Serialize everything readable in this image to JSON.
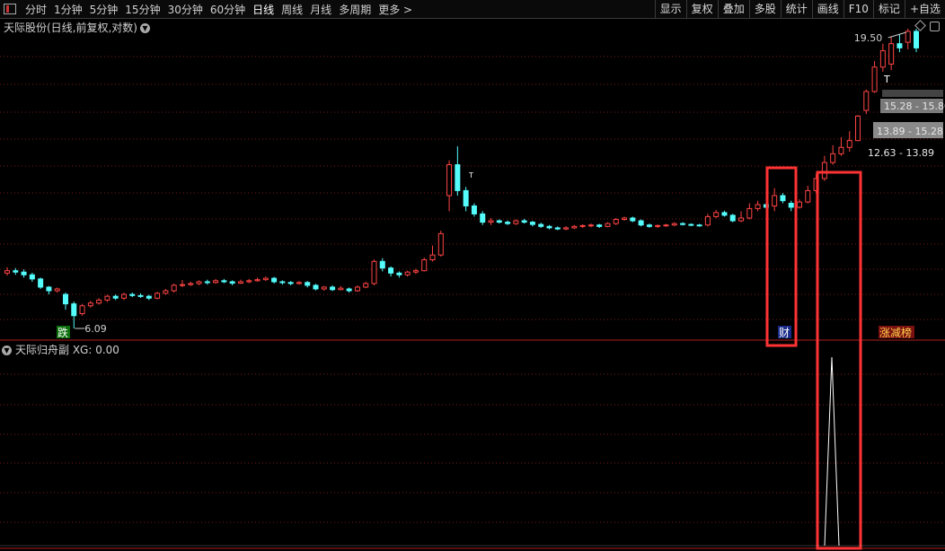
{
  "toolbar": {
    "periods": [
      "分时",
      "1分钟",
      "5分钟",
      "15分钟",
      "30分钟",
      "60分钟",
      "日线",
      "周线",
      "月线",
      "多周期",
      "更多 >"
    ],
    "active_period": "日线",
    "right_buttons": [
      "显示",
      "复权",
      "叠加",
      "多股",
      "统计",
      "画线",
      "F10",
      "标记",
      "+自选"
    ]
  },
  "chart": {
    "title": "天际股份(日线,前复权,对数)",
    "high_label": "19.50",
    "low_label": "6.09",
    "marker_die": "跌",
    "marker_cai": "财",
    "marker_zdb": "涨减榜",
    "zones": [
      "15.28 - 15.80",
      "13.89 - 15.28",
      "12.63 - 13.89"
    ],
    "t_marks": [
      "T",
      "T"
    ]
  },
  "indicator": {
    "title": "天际归舟副 XG: 0.00",
    "value": 0.0
  },
  "colors": {
    "up": "#ff4444",
    "down": "#54fcfc",
    "grid": "#7a1a1a",
    "box": "#ff3333"
  },
  "chart_data": {
    "type": "candlestick",
    "title": "天际股份(日线,前复权,对数)",
    "candles": [
      [
        7.55,
        7.62,
        7.72,
        7.48
      ],
      [
        7.62,
        7.58,
        7.7,
        7.5
      ],
      [
        7.58,
        7.5,
        7.66,
        7.42
      ],
      [
        7.5,
        7.38,
        7.56,
        7.3
      ],
      [
        7.38,
        7.15,
        7.42,
        7.1
      ],
      [
        7.15,
        7.05,
        7.18,
        6.95
      ],
      [
        7.05,
        7.1,
        7.14,
        7.0
      ],
      [
        6.95,
        6.7,
        7.0,
        6.55
      ],
      [
        6.7,
        6.4,
        6.76,
        6.09
      ],
      [
        6.45,
        6.65,
        6.7,
        6.4
      ],
      [
        6.65,
        6.72,
        6.78,
        6.6
      ],
      [
        6.72,
        6.8,
        6.85,
        6.68
      ],
      [
        6.8,
        6.9,
        6.94,
        6.75
      ],
      [
        6.9,
        6.85,
        6.95,
        6.8
      ],
      [
        6.85,
        6.95,
        7.0,
        6.8
      ],
      [
        6.95,
        6.92,
        7.0,
        6.88
      ],
      [
        6.92,
        6.9,
        6.98,
        6.86
      ],
      [
        6.9,
        6.85,
        6.94,
        6.8
      ],
      [
        6.85,
        6.98,
        7.02,
        6.82
      ],
      [
        6.98,
        7.05,
        7.1,
        6.94
      ],
      [
        7.05,
        7.2,
        7.25,
        7.0
      ],
      [
        7.2,
        7.22,
        7.35,
        7.15
      ],
      [
        7.22,
        7.25,
        7.3,
        7.18
      ],
      [
        7.25,
        7.3,
        7.34,
        7.2
      ],
      [
        7.3,
        7.28,
        7.36,
        7.22
      ],
      [
        7.28,
        7.33,
        7.38,
        7.24
      ],
      [
        7.33,
        7.3,
        7.38,
        7.26
      ],
      [
        7.3,
        7.26,
        7.34,
        7.2
      ],
      [
        7.26,
        7.3,
        7.36,
        7.24
      ],
      [
        7.3,
        7.33,
        7.38,
        7.26
      ],
      [
        7.33,
        7.36,
        7.42,
        7.3
      ],
      [
        7.36,
        7.4,
        7.45,
        7.32
      ],
      [
        7.4,
        7.3,
        7.44,
        7.25
      ],
      [
        7.3,
        7.28,
        7.34,
        7.22
      ],
      [
        7.28,
        7.25,
        7.32,
        7.2
      ],
      [
        7.25,
        7.28,
        7.32,
        7.22
      ],
      [
        7.28,
        7.2,
        7.32,
        7.14
      ],
      [
        7.2,
        7.1,
        7.24,
        7.06
      ],
      [
        7.1,
        7.15,
        7.18,
        7.05
      ],
      [
        7.15,
        7.08,
        7.2,
        7.04
      ],
      [
        7.08,
        7.12,
        7.18,
        7.06
      ],
      [
        7.1,
        7.05,
        7.14,
        7.0
      ],
      [
        7.05,
        7.15,
        7.2,
        7.02
      ],
      [
        7.15,
        7.25,
        7.3,
        7.12
      ],
      [
        7.25,
        7.9,
        7.96,
        7.2
      ],
      [
        7.9,
        7.7,
        8.0,
        7.6
      ],
      [
        7.7,
        7.55,
        7.75,
        7.45
      ],
      [
        7.55,
        7.5,
        7.6,
        7.42
      ],
      [
        7.5,
        7.58,
        7.62,
        7.45
      ],
      [
        7.58,
        7.62,
        7.68,
        7.52
      ],
      [
        7.62,
        7.95,
        8.02,
        7.6
      ],
      [
        7.95,
        8.1,
        8.4,
        7.9
      ],
      [
        8.1,
        8.8,
        8.9,
        8.05
      ],
      [
        10.2,
        11.5,
        11.7,
        9.6
      ],
      [
        11.5,
        10.4,
        12.35,
        10.2
      ],
      [
        10.4,
        9.8,
        10.55,
        9.6
      ],
      [
        9.8,
        9.5,
        9.9,
        9.4
      ],
      [
        9.5,
        9.2,
        9.6,
        9.1
      ],
      [
        9.2,
        9.25,
        9.35,
        9.1
      ],
      [
        9.25,
        9.2,
        9.3,
        9.15
      ],
      [
        9.2,
        9.15,
        9.26,
        9.1
      ],
      [
        9.15,
        9.25,
        9.3,
        9.1
      ],
      [
        9.25,
        9.2,
        9.32,
        9.15
      ],
      [
        9.2,
        9.12,
        9.25,
        9.05
      ],
      [
        9.12,
        9.05,
        9.18,
        9.0
      ],
      [
        9.05,
        9.0,
        9.1,
        8.95
      ],
      [
        9.0,
        8.96,
        9.05,
        8.92
      ],
      [
        8.96,
        9.0,
        9.06,
        8.92
      ],
      [
        9.0,
        9.05,
        9.1,
        8.96
      ],
      [
        9.05,
        9.08,
        9.12,
        9.0
      ],
      [
        9.08,
        9.1,
        9.15,
        9.02
      ],
      [
        9.1,
        9.05,
        9.14,
        9.0
      ],
      [
        9.05,
        9.15,
        9.2,
        9.02
      ],
      [
        9.15,
        9.3,
        9.35,
        9.1
      ],
      [
        9.3,
        9.35,
        9.4,
        9.25
      ],
      [
        9.35,
        9.25,
        9.4,
        9.2
      ],
      [
        9.25,
        9.1,
        9.3,
        9.05
      ],
      [
        9.1,
        9.05,
        9.15,
        9.0
      ],
      [
        9.05,
        9.08,
        9.12,
        9.0
      ],
      [
        9.08,
        9.1,
        9.14,
        9.04
      ],
      [
        9.1,
        9.15,
        9.2,
        9.06
      ],
      [
        9.15,
        9.12,
        9.2,
        9.08
      ],
      [
        9.12,
        9.1,
        9.16,
        9.06
      ],
      [
        9.1,
        9.08,
        9.14,
        9.04
      ],
      [
        9.1,
        9.4,
        9.5,
        9.05
      ],
      [
        9.4,
        9.55,
        9.65,
        9.35
      ],
      [
        9.55,
        9.45,
        9.62,
        9.4
      ],
      [
        9.45,
        9.25,
        9.5,
        9.2
      ],
      [
        9.25,
        9.35,
        9.6,
        9.2
      ],
      [
        9.35,
        9.7,
        9.9,
        9.3
      ],
      [
        9.7,
        9.85,
        10.0,
        9.6
      ],
      [
        9.85,
        9.75,
        9.9,
        9.7
      ],
      [
        9.8,
        10.2,
        10.5,
        9.6
      ],
      [
        10.2,
        10.0,
        10.3,
        9.9
      ],
      [
        9.9,
        9.75,
        10.0,
        9.6
      ],
      [
        9.75,
        9.95,
        10.05,
        9.7
      ],
      [
        9.95,
        10.4,
        10.6,
        9.9
      ],
      [
        10.4,
        10.9,
        11.1,
        10.3
      ],
      [
        10.9,
        11.6,
        11.9,
        10.8
      ],
      [
        11.6,
        12.0,
        12.4,
        11.5
      ],
      [
        12.0,
        12.3,
        12.8,
        11.9
      ],
      [
        12.3,
        12.63,
        13.1,
        12.1
      ],
      [
        12.63,
        13.89,
        13.95,
        12.6
      ],
      [
        14.2,
        15.28,
        15.4,
        14.0
      ],
      [
        15.28,
        16.8,
        17.2,
        15.2
      ],
      [
        16.8,
        17.9,
        18.4,
        16.5
      ],
      [
        17.0,
        18.4,
        18.9,
        16.6
      ],
      [
        18.4,
        18.1,
        19.1,
        17.8
      ],
      [
        18.5,
        19.3,
        19.5,
        18.0
      ],
      [
        19.3,
        18.1,
        19.5,
        17.8
      ]
    ],
    "price_scale": "log",
    "high": 19.5,
    "low": 6.09
  }
}
